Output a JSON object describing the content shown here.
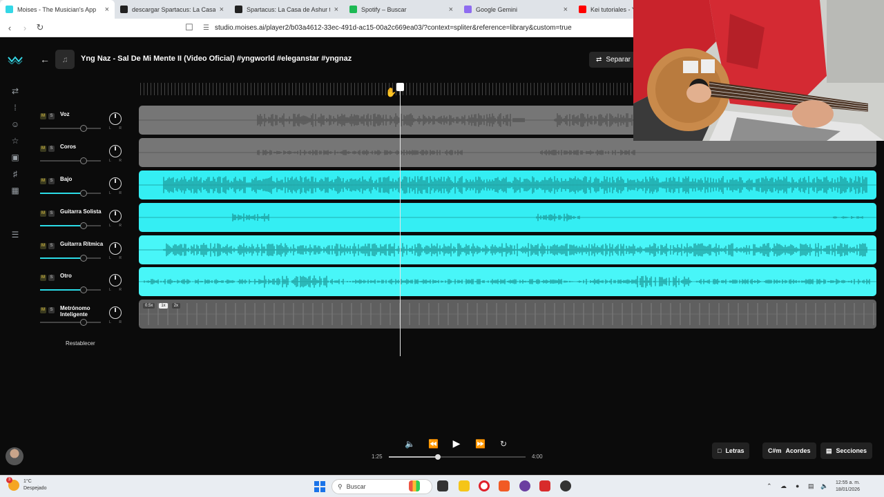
{
  "browser": {
    "tabs": [
      {
        "title": "Moises - The Musician's App",
        "color": "#34d7e6",
        "active": true
      },
      {
        "title": "descargar Spartacus: La Casa de Ashur",
        "color": "#222222",
        "active": false
      },
      {
        "title": "Spartacus: La Casa de Ashur tempora",
        "color": "#222222",
        "active": false
      },
      {
        "title": "Spotify – Buscar",
        "color": "#1db954",
        "active": false
      },
      {
        "title": "Google Gemini",
        "color": "#8e6cf0",
        "active": false
      },
      {
        "title": "Kei tutoriales - YouTube",
        "color": "#ff0000",
        "active": false
      }
    ],
    "url": "studio.moises.ai/player2/b03a4612-33ec-491d-ac15-00a2c669ea03/?context=spliter&reference=library&custom=true"
  },
  "app": {
    "song_title": "Yng Naz - Sal De Mi Mente II (Video Oficial) #yngworld #eleganstar #yngnaz",
    "separate_label": "Separar",
    "reset_label": "Restablecer",
    "mute_label": "M",
    "solo_label": "S",
    "tracks": [
      {
        "name": "Voz",
        "volume": 0.72,
        "style": "gray"
      },
      {
        "name": "Coros",
        "volume": 0.72,
        "style": "gray"
      },
      {
        "name": "Bajo",
        "volume": 0.72,
        "style": "cyan"
      },
      {
        "name": "Guitarra Solista",
        "volume": 0.72,
        "style": "cyan"
      },
      {
        "name": "Guitarra Rítmica",
        "volume": 0.72,
        "style": "cyan"
      },
      {
        "name": "Otro",
        "volume": 0.72,
        "style": "cyan"
      },
      {
        "name": "Metrónomo Inteligente",
        "volume": 0.72,
        "style": "metro"
      }
    ],
    "metronome_speeds": [
      "0.5x",
      "1x",
      "2x"
    ],
    "metronome_speed_selected": "1x",
    "transport": {
      "current_time": "1:25",
      "total_time": "4:00",
      "progress": 0.354
    },
    "bottom_buttons": {
      "lyrics": "Letras",
      "chords_prefix": "C#m",
      "chords": "Acordes",
      "sections": "Secciones"
    }
  },
  "taskbar": {
    "weather_badge": "3",
    "temperature": "1°C",
    "weather": "Despejado",
    "search_placeholder": "Buscar",
    "time": "12:55 a. m.",
    "date": "18/01/2026"
  },
  "colors": {
    "accent": "#2bdde8",
    "track_cyan": "#34eef3",
    "track_gray": "#767676",
    "wave_cyan": "#1a8f8f",
    "wave_gray": "#4e4e4e"
  }
}
